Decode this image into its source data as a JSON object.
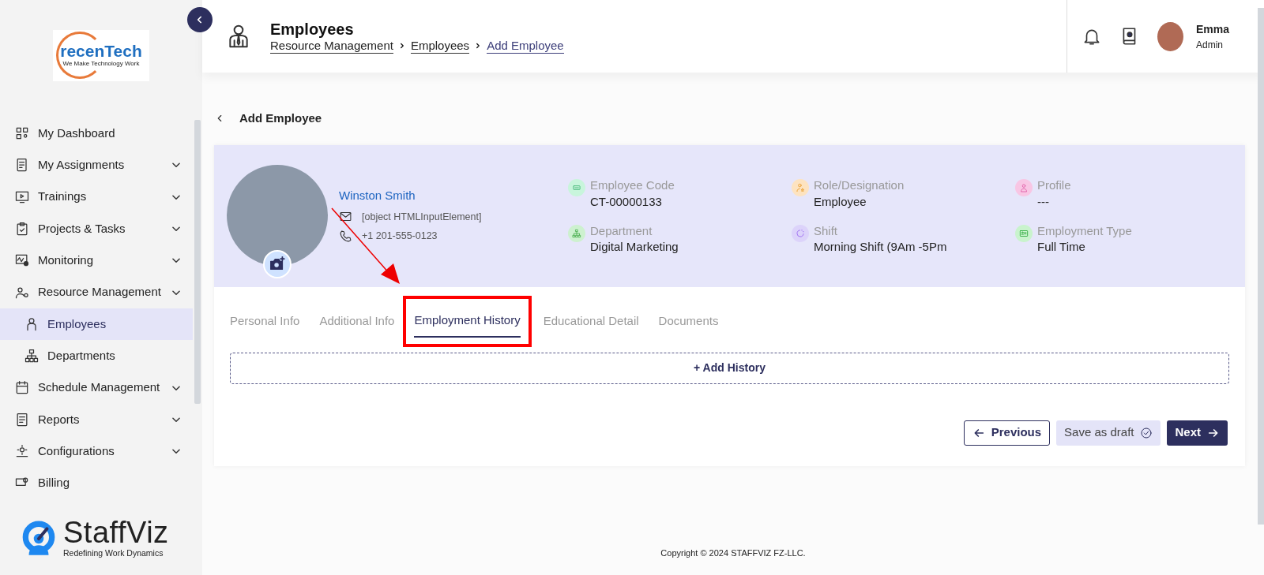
{
  "sidebar": {
    "company_logo": {
      "name": "recenTech",
      "tagline": "We Make Technology Work"
    },
    "items": [
      {
        "label": "My Dashboard",
        "has_submenu": false,
        "selected": false
      },
      {
        "label": "My Assignments",
        "has_submenu": true,
        "selected": false
      },
      {
        "label": "Trainings",
        "has_submenu": true,
        "selected": false
      },
      {
        "label": "Projects & Tasks",
        "has_submenu": true,
        "selected": false
      },
      {
        "label": "Monitoring",
        "has_submenu": true,
        "selected": false
      },
      {
        "label": "Resource Management",
        "has_submenu": true,
        "selected": false,
        "children": [
          {
            "label": "Employees",
            "selected": true
          },
          {
            "label": "Departments",
            "selected": false
          }
        ]
      },
      {
        "label": "Schedule Management",
        "has_submenu": true,
        "selected": false
      },
      {
        "label": "Reports",
        "has_submenu": true,
        "selected": false
      },
      {
        "label": "Configurations",
        "has_submenu": true,
        "selected": false
      },
      {
        "label": "Billing",
        "has_submenu": false,
        "selected": false
      }
    ],
    "brand_logo": {
      "name": "StaffViz",
      "tagline": "Redefining Work Dynamics"
    }
  },
  "header": {
    "title": "Employees",
    "breadcrumb": [
      {
        "label": "Resource Management",
        "current": false
      },
      {
        "label": "Employees",
        "current": false
      },
      {
        "label": "Add Employee",
        "current": true
      }
    ],
    "user": {
      "name": "Emma",
      "role": "Admin"
    }
  },
  "page": {
    "back_label": "Add Employee"
  },
  "profile": {
    "name": "Winston Smith",
    "email": "[object HTMLInputElement]",
    "phone": "+1 201-555-0123",
    "fields": [
      {
        "label": "Employee Code",
        "value": "CT-00000133",
        "color": "#c8f5dc"
      },
      {
        "label": "Role/Designation",
        "value": "Employee",
        "color": "#fde3c0"
      },
      {
        "label": "Profile",
        "value": "---",
        "color": "#f8c6e4"
      },
      {
        "label": "Department",
        "value": "Digital Marketing",
        "color": "#cdf1cf"
      },
      {
        "label": "Shift",
        "value": "Morning Shift (9Am -5Pm",
        "color": "#dcd3fa"
      },
      {
        "label": "Employment Type",
        "value": "Full Time",
        "color": "#c9f3cd"
      }
    ]
  },
  "tabs": [
    {
      "label": "Personal Info",
      "selected": false,
      "highlighted": false
    },
    {
      "label": "Additional Info",
      "selected": false,
      "highlighted": false
    },
    {
      "label": "Employment History",
      "selected": true,
      "highlighted": true
    },
    {
      "label": "Educational Detail",
      "selected": false,
      "highlighted": false
    },
    {
      "label": "Documents",
      "selected": false,
      "highlighted": false
    }
  ],
  "add_history": {
    "label": "+ Add History"
  },
  "buttons": [
    {
      "label": "Previous",
      "kind": "back"
    },
    {
      "label": "Save as draft",
      "kind": "draft"
    },
    {
      "label": "Next",
      "kind": "next"
    }
  ],
  "footer": {
    "copyright": "Copyright © 2024 STAFFVIZ FZ-LLC."
  }
}
